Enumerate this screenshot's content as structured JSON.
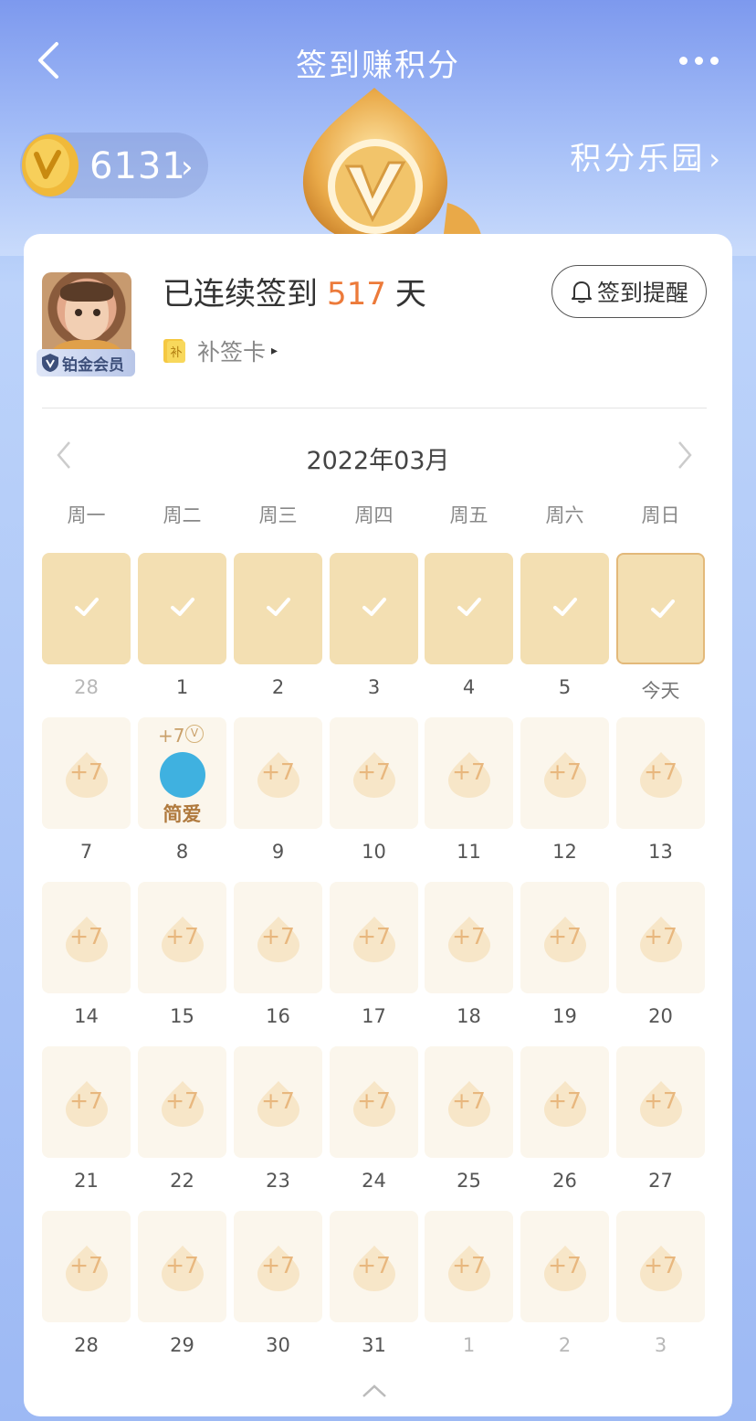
{
  "header": {
    "title": "签到赚积分"
  },
  "points": {
    "value": "6131",
    "chevron": "›"
  },
  "park_link": {
    "label": "积分乐园",
    "chevron": "›"
  },
  "profile": {
    "badge": "铂金会员",
    "streak_prefix": "已连续签到",
    "streak_days": "517",
    "streak_suffix": "天",
    "makeup_card": "补签卡",
    "makeup_chevron": "▸",
    "remind_button": "签到提醒"
  },
  "calendar": {
    "month": "2022年03月",
    "weekdays": [
      "周一",
      "周二",
      "周三",
      "周四",
      "周五",
      "周六",
      "周日"
    ],
    "reward_text": "+7",
    "rows": [
      [
        {
          "day": "28",
          "state": "signed",
          "muted": true
        },
        {
          "day": "1",
          "state": "signed"
        },
        {
          "day": "2",
          "state": "signed"
        },
        {
          "day": "3",
          "state": "signed"
        },
        {
          "day": "4",
          "state": "signed"
        },
        {
          "day": "5",
          "state": "signed"
        },
        {
          "day": "今天",
          "state": "today"
        }
      ],
      [
        {
          "day": "7",
          "state": "future"
        },
        {
          "day": "8",
          "state": "special",
          "reward": "+7",
          "reward_icon": "V",
          "name": "简爱"
        },
        {
          "day": "9",
          "state": "future"
        },
        {
          "day": "10",
          "state": "future"
        },
        {
          "day": "11",
          "state": "future"
        },
        {
          "day": "12",
          "state": "future"
        },
        {
          "day": "13",
          "state": "future"
        }
      ],
      [
        {
          "day": "14",
          "state": "future"
        },
        {
          "day": "15",
          "state": "future"
        },
        {
          "day": "16",
          "state": "future"
        },
        {
          "day": "17",
          "state": "future"
        },
        {
          "day": "18",
          "state": "future"
        },
        {
          "day": "19",
          "state": "future"
        },
        {
          "day": "20",
          "state": "future"
        }
      ],
      [
        {
          "day": "21",
          "state": "future"
        },
        {
          "day": "22",
          "state": "future"
        },
        {
          "day": "23",
          "state": "future"
        },
        {
          "day": "24",
          "state": "future"
        },
        {
          "day": "25",
          "state": "future"
        },
        {
          "day": "26",
          "state": "future"
        },
        {
          "day": "27",
          "state": "future"
        }
      ],
      [
        {
          "day": "28",
          "state": "future"
        },
        {
          "day": "29",
          "state": "future"
        },
        {
          "day": "30",
          "state": "future"
        },
        {
          "day": "31",
          "state": "future"
        },
        {
          "day": "1",
          "state": "future",
          "muted": true
        },
        {
          "day": "2",
          "state": "future",
          "muted": true
        },
        {
          "day": "3",
          "state": "future",
          "muted": true
        }
      ]
    ]
  },
  "colors": {
    "accent": "#ec7a3a",
    "signed_cell": "#f3dfb2",
    "future_cell": "#fbf6ec",
    "reward_text": "#e8b77e"
  },
  "icons": [
    "back-arrow-icon",
    "more-dots-icon",
    "coin-icon",
    "mascot-icon",
    "badge-shield-icon",
    "makeup-card-icon",
    "bell-icon",
    "chevron-left-icon",
    "chevron-right-icon",
    "check-icon",
    "drop-icon",
    "collapse-up-icon"
  ]
}
